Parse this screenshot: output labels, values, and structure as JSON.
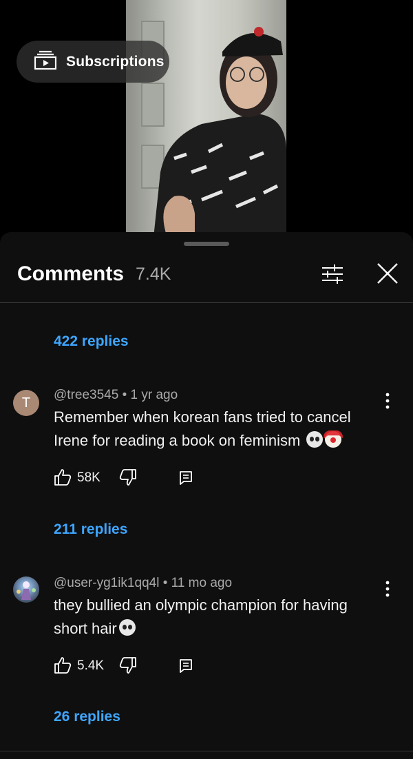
{
  "video": {
    "subscriptions_label": "Subscriptions"
  },
  "comments_panel": {
    "title": "Comments",
    "count": "7.4K"
  },
  "threads": [
    {
      "replies_label": "422 replies"
    },
    {
      "avatar_letter": "T",
      "author": "@tree3545",
      "time": "1 yr ago",
      "text": "Remember when korean fans tried to cancel Irene for reading a book on feminism",
      "emojis": [
        "skull",
        "clown"
      ],
      "likes": "58K",
      "replies_label": "211 replies"
    },
    {
      "author": "@user-yg1ik1qq4l",
      "time": "11 mo ago",
      "text": "they bullied an olympic champion for having short hair",
      "emojis": [
        "skull"
      ],
      "likes": "5.4K",
      "replies_label": "26 replies"
    }
  ],
  "colors": {
    "sheet_bg": "#0f0f0f",
    "link_blue": "#3ea6ff",
    "secondary_text": "#aaaaaa"
  }
}
